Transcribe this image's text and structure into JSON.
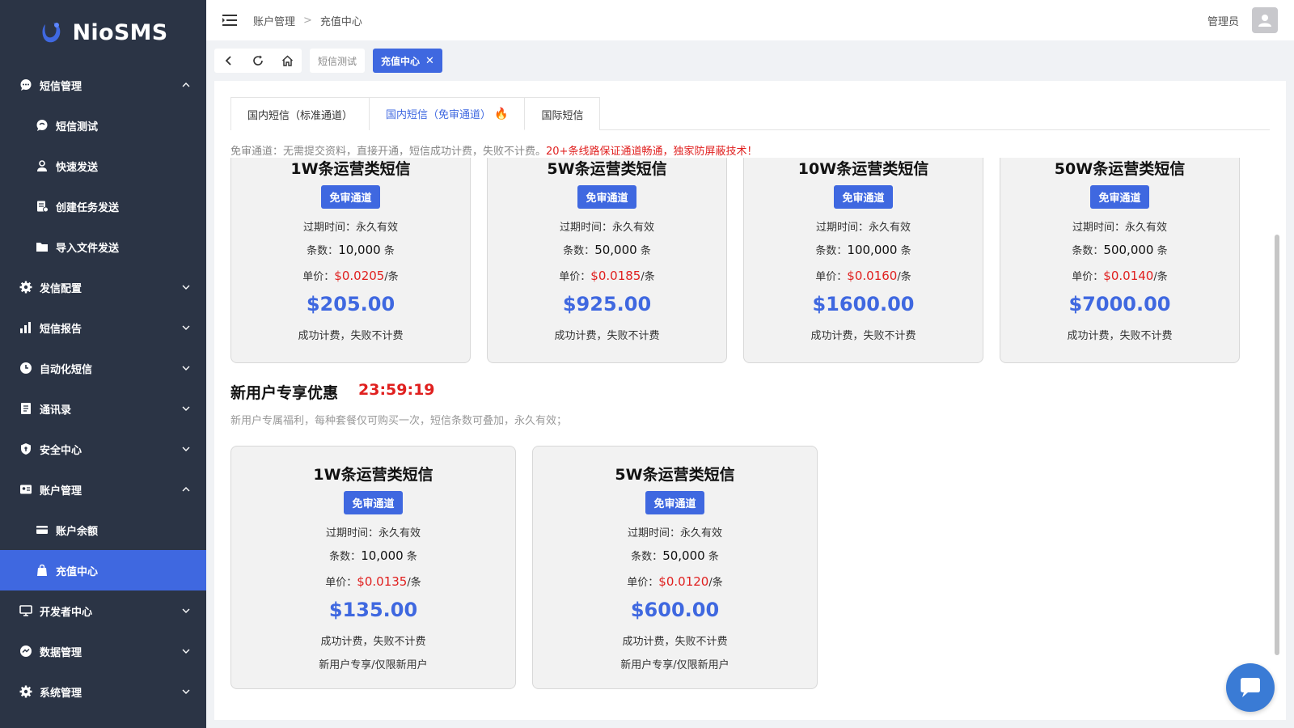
{
  "app": {
    "name": "NioSMS",
    "brand_color": "#3f68e0",
    "sidebar_color": "#2b3445"
  },
  "sidebar": {
    "items": [
      {
        "label": "短信管理",
        "icon": "chat-bubble-icon",
        "expanded": true
      },
      {
        "label": "短信测试",
        "icon": "message-icon",
        "sub": true
      },
      {
        "label": "快速发送",
        "icon": "user-send-icon",
        "sub": true
      },
      {
        "label": "创建任务发送",
        "icon": "task-icon",
        "sub": true
      },
      {
        "label": "导入文件发送",
        "icon": "folder-icon",
        "sub": true
      },
      {
        "label": "发信配置",
        "icon": "gear-icon"
      },
      {
        "label": "短信报告",
        "icon": "bar-chart-icon"
      },
      {
        "label": "自动化短信",
        "icon": "clock-icon"
      },
      {
        "label": "通讯录",
        "icon": "address-book-icon"
      },
      {
        "label": "安全中心",
        "icon": "shield-icon"
      },
      {
        "label": "账户管理",
        "icon": "id-card-icon",
        "expanded": true
      },
      {
        "label": "账户余额",
        "icon": "wallet-icon",
        "sub": true
      },
      {
        "label": "充值中心",
        "icon": "bag-icon",
        "sub": true,
        "active": true
      },
      {
        "label": "开发者中心",
        "icon": "monitor-icon"
      },
      {
        "label": "数据管理",
        "icon": "data-icon"
      },
      {
        "label": "系统管理",
        "icon": "gear-icon"
      }
    ]
  },
  "header": {
    "breadcrumb": [
      "账户管理",
      "充值中心"
    ],
    "user_name": "管理员"
  },
  "page_tabs": [
    {
      "label": "短信测试"
    },
    {
      "label": "充值中心",
      "active": true
    }
  ],
  "content_tabs": [
    {
      "label": "国内短信（标准通道）"
    },
    {
      "label": "国内短信（免审通道）",
      "active": true
    },
    {
      "label": "国际短信"
    }
  ],
  "notice": {
    "gray": "免审通道：无需提交资料，直接开通，短信成功计费，失败不计费。",
    "red": "20+条线路保证通道畅通，独家防屏蔽技术！"
  },
  "labels": {
    "expire_prefix": "过期时间：",
    "count_prefix": "条数：",
    "count_unit": " 条",
    "price_prefix": "单价：",
    "price_unit": "/条"
  },
  "packages": [
    {
      "title": "1W条运营类短信",
      "badge": "免审通道",
      "expire": "永久有效",
      "count": "10,000",
      "unit_price": "$0.0205",
      "total": "$205.00",
      "note": "成功计费，失败不计费"
    },
    {
      "title": "5W条运营类短信",
      "badge": "免审通道",
      "expire": "永久有效",
      "count": "50,000",
      "unit_price": "$0.0185",
      "total": "$925.00",
      "note": "成功计费，失败不计费"
    },
    {
      "title": "10W条运营类短信",
      "badge": "免审通道",
      "expire": "永久有效",
      "count": "100,000",
      "unit_price": "$0.0160",
      "total": "$1600.00",
      "note": "成功计费，失败不计费"
    },
    {
      "title": "50W条运营类短信",
      "badge": "免审通道",
      "expire": "永久有效",
      "count": "500,000",
      "unit_price": "$0.0140",
      "total": "$7000.00",
      "note": "成功计费，失败不计费"
    }
  ],
  "promo": {
    "title": "新用户专享优惠",
    "timer": "23:59:19",
    "desc": "新用户专属福利，每种套餐仅可购买一次，短信条数可叠加，永久有效；",
    "packages": [
      {
        "title": "1W条运营类短信",
        "badge": "免审通道",
        "expire": "永久有效",
        "count": "10,000",
        "unit_price": "$0.0135",
        "total": "$135.00",
        "note": "成功计费，失败不计费",
        "note2": "新用户专享/仅限新用户"
      },
      {
        "title": "5W条运营类短信",
        "badge": "免审通道",
        "expire": "永久有效",
        "count": "50,000",
        "unit_price": "$0.0120",
        "total": "$600.00",
        "note": "成功计费，失败不计费",
        "note2": "新用户专享/仅限新用户"
      }
    ]
  }
}
